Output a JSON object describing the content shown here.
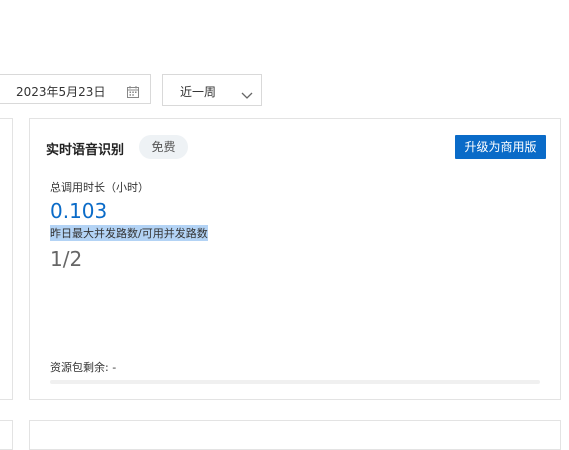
{
  "filters": {
    "range_separator": "-",
    "date_end": "2023年5月23日",
    "period": "近一周"
  },
  "card": {
    "title": "实时语音识别",
    "badge": "免费",
    "upgrade_button": "升级为商用版",
    "metrics": [
      {
        "label": "总调用时长（小时）",
        "value": "0.103"
      },
      {
        "label": "昨日最大并发路数/可用并发路数",
        "value": "1/2"
      }
    ],
    "resource_label": "资源包剩余: -"
  },
  "colors": {
    "accent": "#0a6bc8",
    "selection": "#b3d3f5"
  },
  "icons": {
    "calendar": "calendar-icon",
    "chevron": "chevron-down-icon"
  }
}
